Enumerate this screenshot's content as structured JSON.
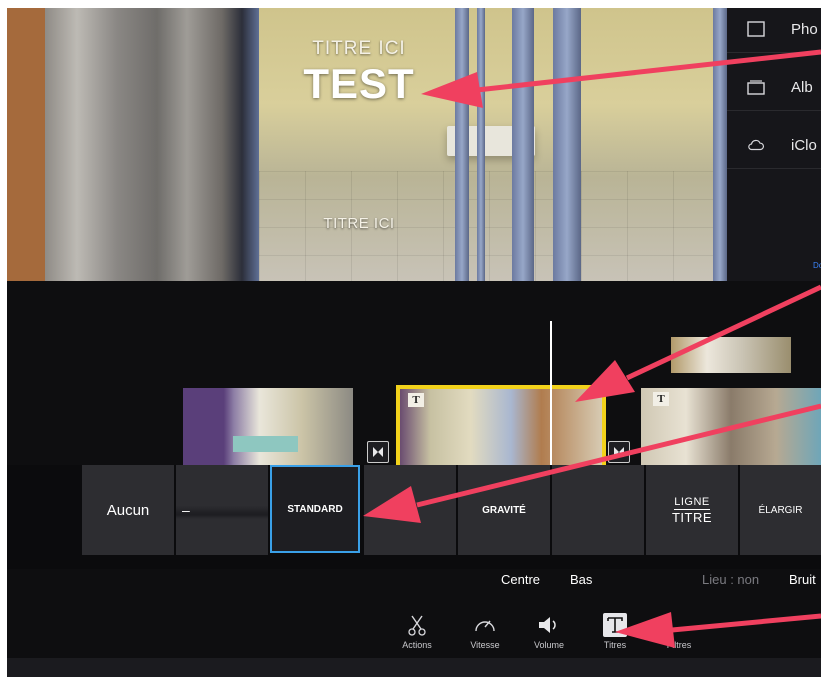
{
  "viewer": {
    "title_top": "TITRE ICI",
    "title_main": "TEST",
    "title_bottom": "TITRE ICI"
  },
  "side_panel": {
    "items": [
      {
        "label": "Pho",
        "icon": "square-icon"
      },
      {
        "label": "Alb",
        "icon": "album-stack-icon"
      },
      {
        "label": "iClo",
        "icon": "cloud-icon"
      }
    ],
    "link_text": "Do"
  },
  "toolbar": {
    "mic_icon": "microphone-icon",
    "camera_icon": "camera-icon",
    "skip_back_icon": "skip-to-start-icon",
    "play_icon": "play-icon"
  },
  "title_styles": {
    "items": [
      "Aucun",
      "–",
      "STANDARD",
      "",
      "GRAVITÉ",
      "",
      "LIGNE\nTITRE",
      "ÉLARGIR"
    ],
    "ligne": "LIGNE",
    "titre": "TITRE",
    "selected": "STANDARD",
    "selected_color": "#3aa0e8"
  },
  "position_options": {
    "centre": "Centre",
    "bas": "Bas",
    "lieu": "Lieu : non",
    "bruit": "Bruit"
  },
  "bottom_toolbar": [
    {
      "label": "Actions",
      "icon": "scissors-icon"
    },
    {
      "label": "Vitesse",
      "icon": "speedometer-icon"
    },
    {
      "label": "Volume",
      "icon": "speaker-icon"
    },
    {
      "label": "Titres",
      "icon": "title-T-icon",
      "active": true
    },
    {
      "label": "Filtres",
      "icon": "filter-icon"
    }
  ],
  "colors": {
    "annotation_arrow": "#f0405f",
    "clip_selected_border": "#f2d21b",
    "background": "#0e0e10"
  }
}
